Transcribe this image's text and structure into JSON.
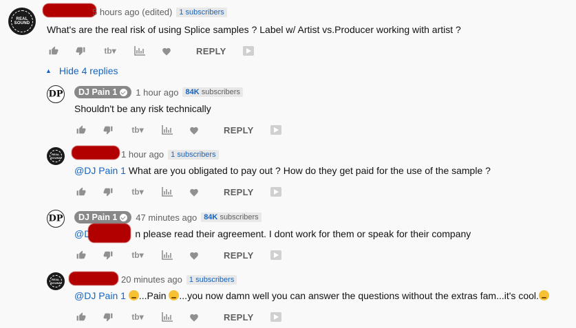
{
  "comments": [
    {
      "author": "",
      "time": "5 hours ago (edited)",
      "subscribers": "1 subscribers",
      "mention": "",
      "text": "What's are the real risk of using Splice samples ? Label w/ Artist vs.Producer working with artist ?",
      "reply_label": "REPLY",
      "avatar_text": "REAL SOUND"
    },
    {
      "author": "DJ Pain 1",
      "time": "1 hour ago",
      "subscribers_num": "84K",
      "subscribers_word": "subscribers",
      "mention": "",
      "text": "Shouldn't be any risk technically",
      "reply_label": "REPLY",
      "avatar_text": "DP"
    },
    {
      "author": "",
      "time": "1 hour ago",
      "subscribers": "1 subscribers",
      "mention": "@DJ Pain 1",
      "text": "What are you obligated to pay out ? How do they get paid for the use of the sample  ?",
      "reply_label": "REPLY",
      "avatar_text": "REAL SOUND"
    },
    {
      "author": "DJ Pain 1",
      "time": "47 minutes ago",
      "subscribers_num": "84K",
      "subscribers_word": "subscribers",
      "mention": "@D",
      "text": "n please read their agreement. I dont work for them or speak for their company",
      "reply_label": "REPLY",
      "avatar_text": "DP"
    },
    {
      "author": "",
      "time": "20 minutes ago",
      "subscribers": "1 subscribers",
      "mention": "@DJ Pain 1",
      "text_a": "...Pain",
      "text_b": "...you now damn well you can answer the questions without the extras fam...it's cool.",
      "reply_label": "REPLY",
      "avatar_text": "REAL SOUND"
    }
  ],
  "hide_replies_label": "Hide 4 replies",
  "icons": [
    "thumb-up-icon",
    "thumb-down-icon",
    "tb-rating-icon",
    "stats-icon",
    "heart-icon",
    "play-pick-icon"
  ],
  "colors": {
    "accent": "#1565c0",
    "redaction": "#b20000",
    "icon": "#909090"
  }
}
